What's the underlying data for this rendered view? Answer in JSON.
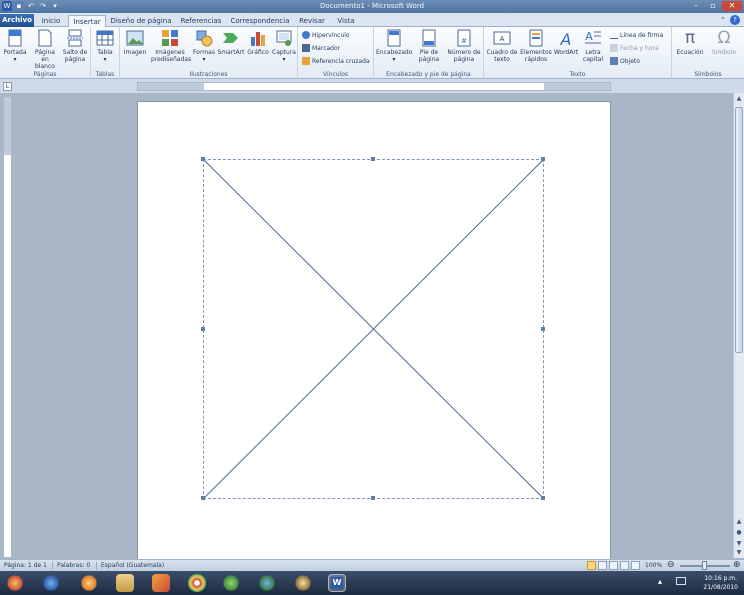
{
  "window": {
    "title": "Documento1 - Microsoft Word"
  },
  "tabs": [
    {
      "label": "Archivo"
    },
    {
      "label": "Inicio"
    },
    {
      "label": "Insertar"
    },
    {
      "label": "Diseño de página"
    },
    {
      "label": "Referencias"
    },
    {
      "label": "Correspondencia"
    },
    {
      "label": "Revisar"
    },
    {
      "label": "Vista"
    }
  ],
  "ribbon": {
    "paginas": {
      "label": "Páginas",
      "portada": "Portada",
      "pagina_blanco": "Página en blanco",
      "salto_pagina": "Salto de página"
    },
    "tablas": {
      "label": "Tablas",
      "tabla": "Tabla"
    },
    "ilustraciones": {
      "label": "Ilustraciones",
      "imagen": "Imagen",
      "imagenes_predisenadas": "Imágenes prediseñadas",
      "formas": "Formas",
      "smartart": "SmartArt",
      "grafico": "Gráfico",
      "captura": "Captura"
    },
    "vinculos": {
      "label": "Vínculos",
      "hipervinculo": "Hipervínculo",
      "marcador": "Marcador",
      "referencia_cruzada": "Referencia cruzada"
    },
    "encabezado": {
      "label": "Encabezado y pie de página",
      "encabezado": "Encabezado",
      "pie_pagina": "Pie de página",
      "numero_pagina": "Número de página"
    },
    "texto": {
      "label": "Texto",
      "cuadro_texto": "Cuadro de texto",
      "elementos_rapidos": "Elementos rápidos",
      "wordart": "WordArt",
      "letra_capital": "Letra capital",
      "linea_firma": "Línea de firma",
      "fecha_hora": "Fecha y hora",
      "objeto": "Objeto"
    },
    "simbolos": {
      "label": "Símbolos",
      "ecuacion": "Ecuación",
      "simbolo": "Símbolo"
    }
  },
  "status": {
    "page": "Página: 1 de 1",
    "words": "Palabras: 0",
    "language": "Español (Guatemala)",
    "zoom": "100%"
  },
  "tray": {
    "time": "10:16 p.m.",
    "date": "21/08/2010"
  },
  "colors": {
    "file_tab": "#2a5ea6",
    "canvas_border": "#7f96b5",
    "line": "#4a6a96"
  }
}
